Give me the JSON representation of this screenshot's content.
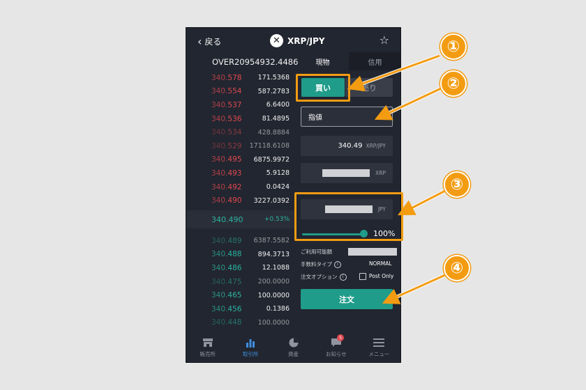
{
  "header": {
    "back_label": "戻る",
    "pair": "XRP/JPY",
    "logo_glyph": "✕",
    "star_glyph": "☆"
  },
  "tabs": [
    {
      "label": "現物"
    },
    {
      "label": "信用"
    }
  ],
  "balance": "OVER20954932.4486",
  "asks": [
    {
      "pre": "340.",
      "suf": "578",
      "qty": "171.5368"
    },
    {
      "pre": "340.",
      "suf": "554",
      "qty": "587.2783"
    },
    {
      "pre": "340.",
      "suf": "537",
      "qty": "6.6400"
    },
    {
      "pre": "340.",
      "suf": "536",
      "qty": "81.4895"
    },
    {
      "pre": "340.",
      "suf": "534",
      "qty": "428.8884"
    },
    {
      "pre": "340.",
      "suf": "529",
      "qty": "17118.6108"
    },
    {
      "pre": "340.",
      "suf": "495",
      "qty": "6875.9972"
    },
    {
      "pre": "340.",
      "suf": "493",
      "qty": "5.9128"
    },
    {
      "pre": "340.",
      "suf": "492",
      "qty": "0.0424"
    },
    {
      "pre": "340.",
      "suf": "490",
      "qty": "3227.0392"
    }
  ],
  "mid": {
    "price": "340.490",
    "change": "+0.53%"
  },
  "bids": [
    {
      "pre": "340.",
      "suf": "489",
      "qty": "6387.5582"
    },
    {
      "pre": "340.",
      "suf": "488",
      "qty": "894.3713"
    },
    {
      "pre": "340.",
      "suf": "486",
      "qty": "12.1088"
    },
    {
      "pre": "340.",
      "suf": "475",
      "qty": "200.0000"
    },
    {
      "pre": "340.",
      "suf": "465",
      "qty": "100.0000"
    },
    {
      "pre": "340.",
      "suf": "456",
      "qty": "0.1386"
    },
    {
      "pre": "340.",
      "suf": "448",
      "qty": "100.0000"
    }
  ],
  "order": {
    "buy_label": "買い",
    "sell_label": "売り",
    "type_label": "指値",
    "price_value": "340.49",
    "price_unit": "XRP/JPY",
    "amount_unit": "XRP",
    "total_unit": "JPY",
    "slider_percent": "100%",
    "available_label": "ご利用可能額",
    "fee_label": "手数料タイプ",
    "fee_value": "NORMAL",
    "option_label": "注文オプション",
    "option_value": "Post Only",
    "submit_label": "注文"
  },
  "nav": [
    {
      "label": "販売所"
    },
    {
      "label": "取引所"
    },
    {
      "label": "資産"
    },
    {
      "label": "お知らせ",
      "badge": "5"
    },
    {
      "label": "メニュー"
    }
  ],
  "callouts": [
    "①",
    "②",
    "③",
    "④"
  ],
  "colors": {
    "accent": "#1f9c8a",
    "ask": "#e0484f",
    "bid": "#2bb3a0",
    "annotation": "#f39c12",
    "nav_active": "#3f8fe0"
  }
}
